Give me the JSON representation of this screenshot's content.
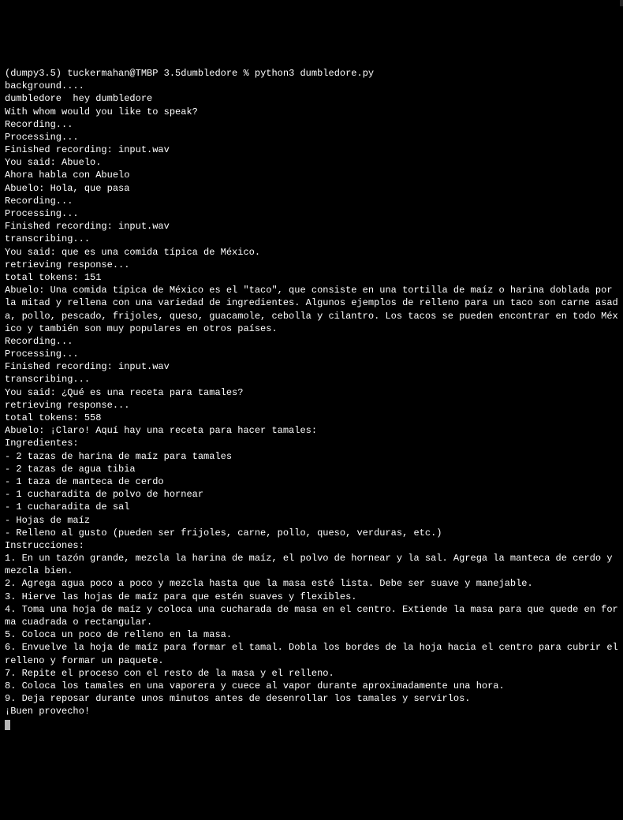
{
  "prompt": {
    "env": "(dumpy3.5)",
    "userhost": "tuckermahan@TMBP",
    "dir": "3.5dumbledore",
    "symbol": "%",
    "command": "python3 dumbledore.py"
  },
  "lines": [
    "background....",
    "dumbledore  hey dumbledore",
    "With whom would you like to speak?",
    "Recording...",
    "Processing...",
    "Finished recording: input.wav",
    "You said: Abuelo.",
    "Ahora habla con Abuelo",
    "Abuelo: Hola, que pasa",
    "Recording...",
    "Processing...",
    "Finished recording: input.wav",
    "transcribing...",
    "You said: que es una comida típica de México.",
    "retrieving response...",
    "total tokens: 151",
    "Abuelo: Una comida típica de México es el \"taco\", que consiste en una tortilla de maíz o harina doblada por la mitad y rellena con una variedad de ingredientes. Algunos ejemplos de relleno para un taco son carne asada, pollo, pescado, frijoles, queso, guacamole, cebolla y cilantro. Los tacos se pueden encontrar en todo México y también son muy populares en otros países.",
    "Recording...",
    "Processing...",
    "Finished recording: input.wav",
    "transcribing...",
    "You said: ¿Qué es una receta para tamales?",
    "retrieving response...",
    "total tokens: 558",
    "Abuelo: ¡Claro! Aquí hay una receta para hacer tamales:",
    "",
    "Ingredientes:",
    "- 2 tazas de harina de maíz para tamales",
    "- 2 tazas de agua tibia",
    "- 1 taza de manteca de cerdo",
    "- 1 cucharadita de polvo de hornear",
    "- 1 cucharadita de sal",
    "- Hojas de maíz",
    "- Relleno al gusto (pueden ser frijoles, carne, pollo, queso, verduras, etc.)",
    "",
    "Instrucciones:",
    "1. En un tazón grande, mezcla la harina de maíz, el polvo de hornear y la sal. Agrega la manteca de cerdo y mezcla bien.",
    "2. Agrega agua poco a poco y mezcla hasta que la masa esté lista. Debe ser suave y manejable.",
    "3. Hierve las hojas de maíz para que estén suaves y flexibles.",
    "4. Toma una hoja de maíz y coloca una cucharada de masa en el centro. Extiende la masa para que quede en forma cuadrada o rectangular.",
    "5. Coloca un poco de relleno en la masa.",
    "6. Envuelve la hoja de maíz para formar el tamal. Dobla los bordes de la hoja hacia el centro para cubrir el relleno y formar un paquete.",
    "7. Repite el proceso con el resto de la masa y el relleno.",
    "8. Coloca los tamales en una vaporera y cuece al vapor durante aproximadamente una hora.",
    "9. Deja reposar durante unos minutos antes de desenrollar los tamales y servirlos.",
    "",
    "¡Buen provecho!"
  ]
}
